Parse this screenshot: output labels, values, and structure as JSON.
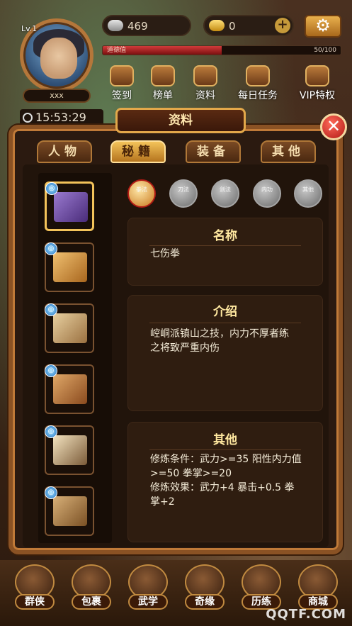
{
  "hud": {
    "level": "Lv.1",
    "player_name": "xxx",
    "silver": "469",
    "gold": "0",
    "exp_label": "道德值",
    "exp_value": "50/100",
    "exp_fraction": 0.5,
    "time": "15:53:29",
    "plus_icon": "plus-icon",
    "settings_icon": "gear-icon"
  },
  "top_menu": [
    "签到",
    "榜单",
    "资料",
    "每日任务",
    "VIP特权"
  ],
  "panel": {
    "title": "资料",
    "close_icon": "close-icon",
    "tabs": [
      "人物",
      "秘籍",
      "装备",
      "其他"
    ],
    "active_tab": 1
  },
  "categories": [
    "拳法",
    "刀法",
    "剑法",
    "内功",
    "其他"
  ],
  "active_category": 0,
  "books": [
    {
      "name": "purple-book",
      "selected": true
    },
    {
      "name": "scroll-1",
      "selected": false
    },
    {
      "name": "scroll-2",
      "selected": false
    },
    {
      "name": "scroll-3",
      "selected": false
    },
    {
      "name": "scroll-4",
      "selected": false
    },
    {
      "name": "scroll-5",
      "selected": false
    }
  ],
  "detail": {
    "name_title": "名称",
    "name": "七伤拳",
    "intro_title": "介绍",
    "intro": "崆峒派镇山之技，内力不厚者练\n之将致严重内伤",
    "other_title": "其他",
    "other": "修炼条件：武力>=35 阳性内力值\n>=50 拳掌>=20\n修炼效果：武力+4 暴击+0.5 拳\n掌+2"
  },
  "bottom_nav": [
    "群侠",
    "包裹",
    "武学",
    "奇缘",
    "历练",
    "商城"
  ],
  "watermark": "QQTF.COM",
  "colors": {
    "accent_gold": "#f3c35a",
    "panel_border": "#8a5224",
    "close_red": "#b01a14"
  }
}
